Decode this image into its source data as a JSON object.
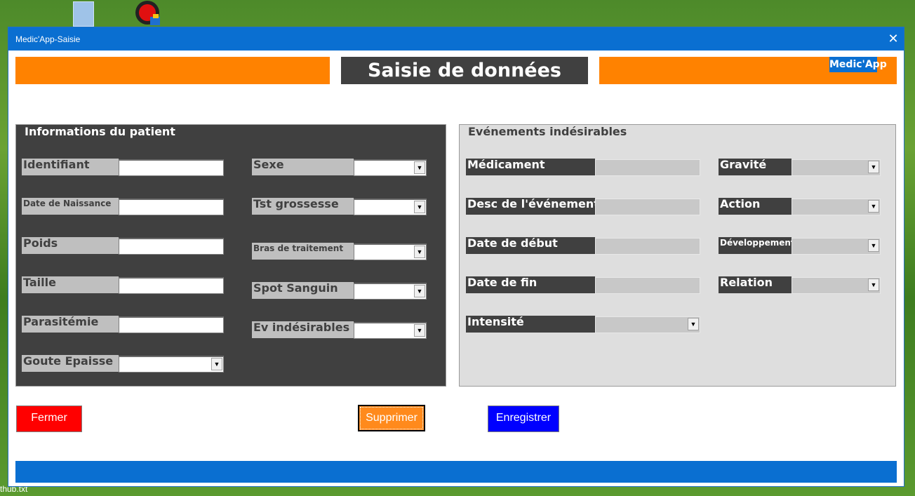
{
  "window": {
    "title": "Medic'App-Saisie",
    "close_glyph": "✕"
  },
  "header": {
    "title": "Saisie de données",
    "logo": "Medic'App"
  },
  "patient_frame": {
    "legend": "Informations du patient",
    "col1_labels": [
      "Identifiant",
      "Date de Naissance",
      "Poids",
      "Taille",
      "Parasitémie",
      "Goute Epaisse"
    ],
    "col2_labels": [
      "Sexe",
      "Tst grossesse",
      "Bras de traitement",
      "Spot Sanguin",
      "Ev indésirables"
    ]
  },
  "events_frame": {
    "legend": "Evénements indésirables",
    "col1_labels": [
      "Médicament",
      "Desc de l'événement",
      "Date de début",
      "Date de fin",
      "Intensité"
    ],
    "col2_labels": [
      "Gravité",
      "Action",
      "Développement",
      "Relation"
    ]
  },
  "buttons": {
    "close": "Fermer",
    "delete": "Supprimer",
    "save": "Enregistrer"
  },
  "desktop": {
    "file_label": "thub.txt"
  },
  "colors": {
    "accent_orange": "#ff8200",
    "accent_blue": "#0a6fd1",
    "dark_gray": "#404040",
    "close_red": "#ff0000",
    "save_blue": "#0000ff"
  }
}
